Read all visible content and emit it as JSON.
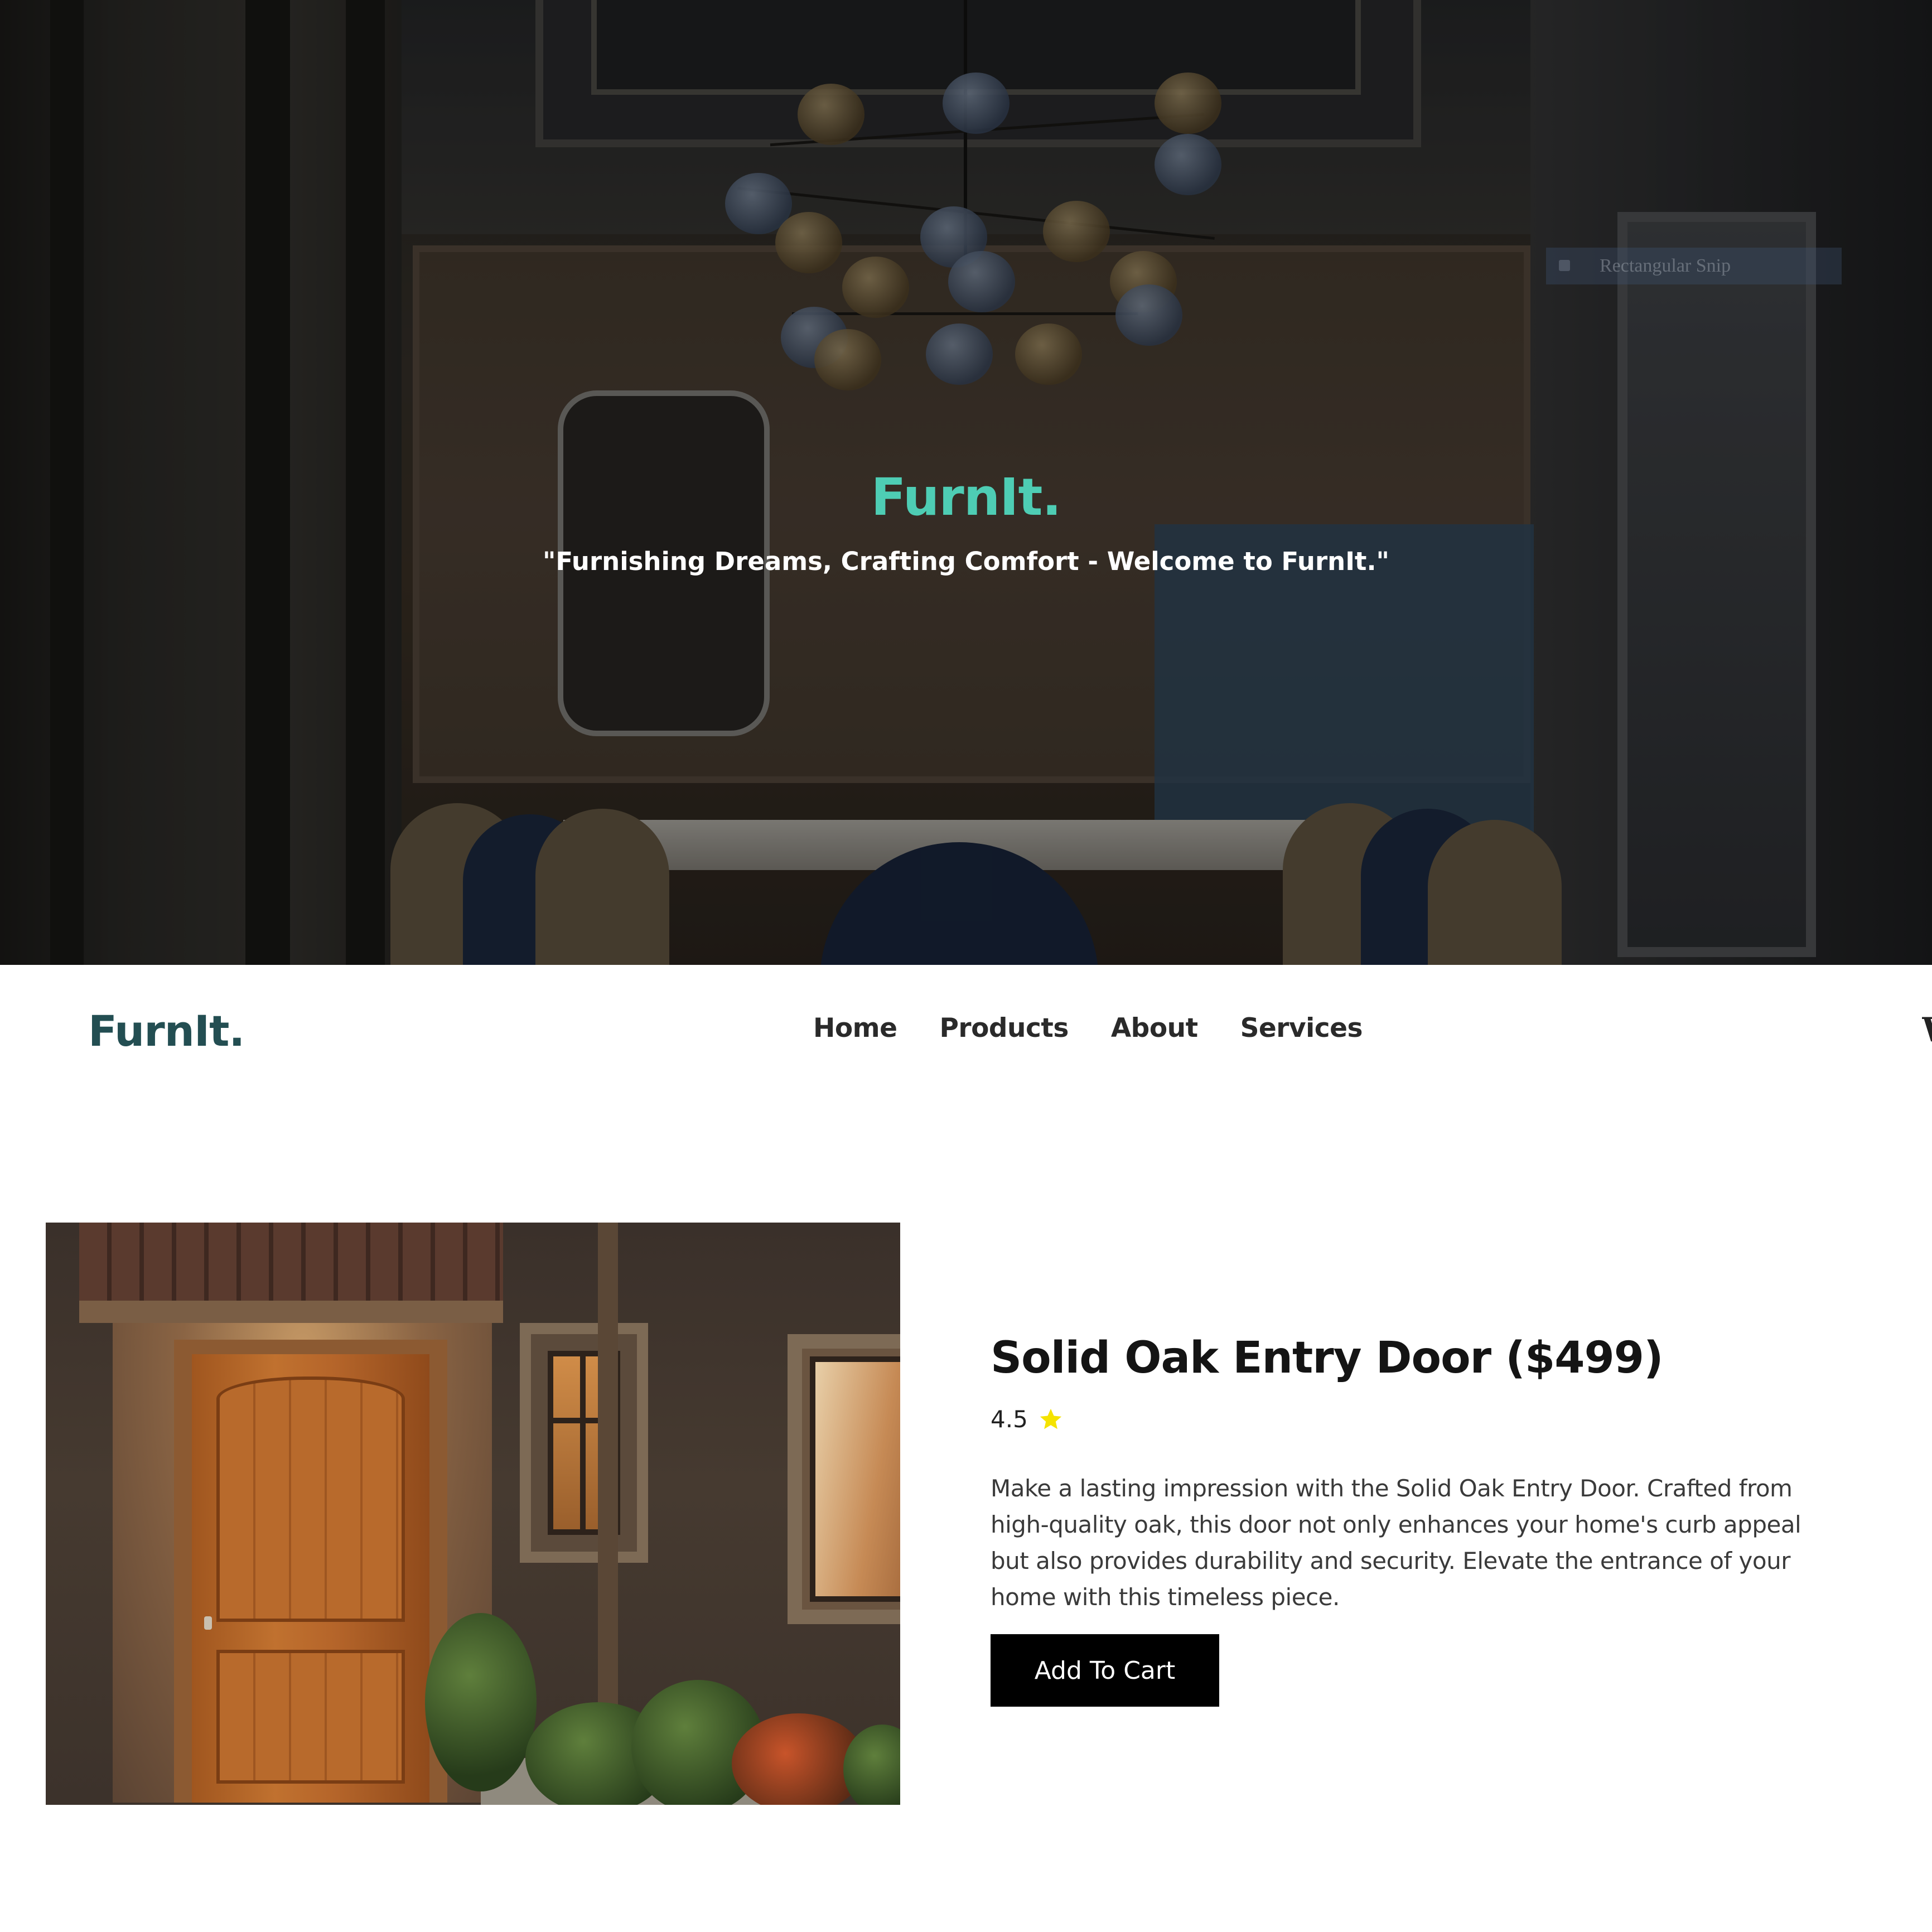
{
  "hero": {
    "brand": "FurnIt.",
    "tagline": "\"Furnishing Dreams, Crafting Comfort - Welcome to FurnIt.\"",
    "snip_label": "Rectangular Snip"
  },
  "navbar": {
    "logo": "FurnIt.",
    "links": [
      "Home",
      "Products",
      "About",
      "Services"
    ]
  },
  "product": {
    "title": "Solid Oak Entry Door ($499)",
    "rating": "4.5",
    "rating_icon": "star-icon",
    "description": "Make a lasting impression with the Solid Oak Entry Door. Crafted from high-quality oak, this door not only enhances your home's curb appeal but also provides durability and security. Elevate the entrance of your home with this timeless piece.",
    "add_to_cart": "Add To Cart"
  },
  "colors": {
    "brand_teal": "#4ecdb4",
    "logo_dark_teal": "#234e52",
    "button_bg": "#000000",
    "star": "#f5e300"
  }
}
